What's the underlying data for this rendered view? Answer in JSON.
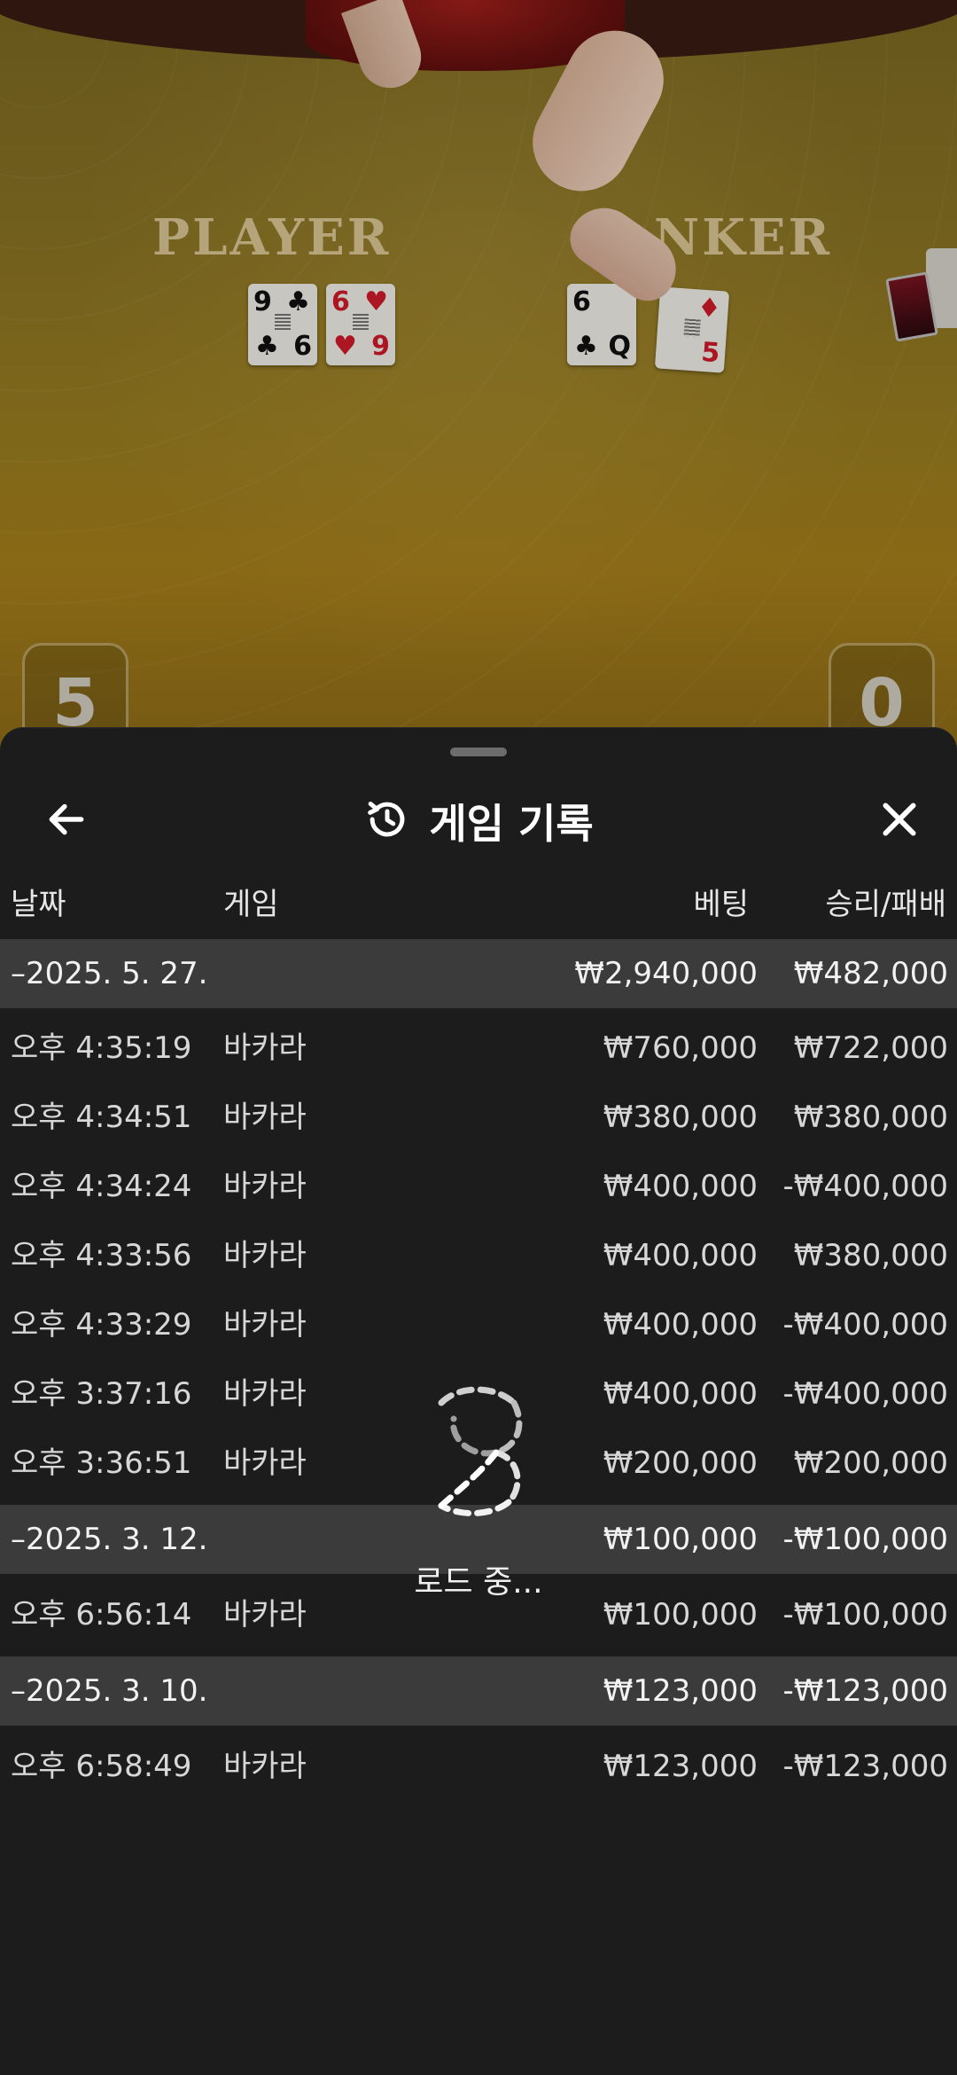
{
  "video": {
    "player_label": "PLAYER",
    "banker_label": "NKER",
    "player_score": "5",
    "banker_score": "0",
    "player_cards": [
      {
        "rank": "9",
        "rank_bottom": "6",
        "suit": "♣",
        "color": "black"
      },
      {
        "rank": "6",
        "rank_bottom": "9",
        "suit": "♥",
        "color": "red"
      }
    ],
    "banker_cards": [
      {
        "rank": "6",
        "rank_bottom": "Q",
        "suit": "♣",
        "color": "black"
      },
      {
        "rank": "",
        "rank_bottom": "5",
        "suit": "♦",
        "color": "red"
      }
    ]
  },
  "sheet": {
    "title": "게임 기록",
    "title_icon": "history-icon",
    "back_icon": "arrow-left-icon",
    "close_icon": "close-icon"
  },
  "columns": {
    "date": "날짜",
    "game": "게임",
    "bet": "베팅",
    "result": "승리/패배"
  },
  "rows": [
    {
      "type": "group",
      "date": "–2025. 5. 27.",
      "game": "",
      "bet": "₩2,940,000",
      "result": "₩482,000"
    },
    {
      "type": "item",
      "date": "오후 4:35:19",
      "game": "바카라",
      "bet": "₩760,000",
      "result": "₩722,000"
    },
    {
      "type": "item",
      "date": "오후 4:34:51",
      "game": "바카라",
      "bet": "₩380,000",
      "result": "₩380,000"
    },
    {
      "type": "item",
      "date": "오후 4:34:24",
      "game": "바카라",
      "bet": "₩400,000",
      "result": "-₩400,000"
    },
    {
      "type": "item",
      "date": "오후 4:33:56",
      "game": "바카라",
      "bet": "₩400,000",
      "result": "₩380,000"
    },
    {
      "type": "item",
      "date": "오후 4:33:29",
      "game": "바카라",
      "bet": "₩400,000",
      "result": "-₩400,000"
    },
    {
      "type": "item",
      "date": "오후 3:37:16",
      "game": "바카라",
      "bet": "₩400,000",
      "result": "-₩400,000"
    },
    {
      "type": "item",
      "date": "오후 3:36:51",
      "game": "바카라",
      "bet": "₩200,000",
      "result": "₩200,000"
    },
    {
      "type": "group",
      "date": "–2025. 3. 12.",
      "game": "",
      "bet": "₩100,000",
      "result": "-₩100,000"
    },
    {
      "type": "item",
      "date": "오후 6:56:14",
      "game": "바카라",
      "bet": "₩100,000",
      "result": "-₩100,000"
    },
    {
      "type": "group",
      "date": "–2025. 3. 10.",
      "game": "",
      "bet": "₩123,000",
      "result": "-₩123,000"
    },
    {
      "type": "item",
      "date": "오후 6:58:49",
      "game": "바카라",
      "bet": "₩123,000",
      "result": "-₩123,000"
    }
  ],
  "loading": {
    "text": "로드 중...",
    "icon": "loading-spinner-icon"
  }
}
